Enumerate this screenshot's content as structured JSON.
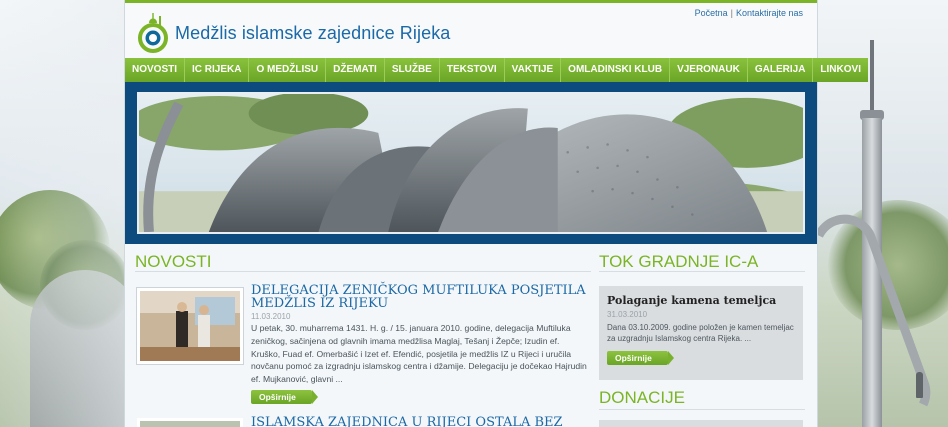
{
  "site": {
    "title": "Medžlis islamske zajednice Rijeka",
    "colors": {
      "accent_green": "#7bb426",
      "brand_blue": "#1a69a8",
      "banner_frame": "#0d4a7d"
    }
  },
  "top_links": {
    "home": "Početna",
    "separator": "|",
    "contact": "Kontaktirajte nas"
  },
  "nav": [
    "NOVOSTI",
    "IC RIJEKA",
    "O MEDŽLISU",
    "DŽEMATI",
    "SLUŽBE",
    "TEKSTOVI",
    "VAKTIJE",
    "OMLADINSKI KLUB",
    "VJERONAUK",
    "GALERIJA",
    "LINKOVI"
  ],
  "news": {
    "heading": "NOVOSTI",
    "articles": [
      {
        "title": "DELEGACIJA ZENIČKOG MUFTILUKA POSJETILA MEDŽLIS IZ RIJEKU",
        "date": "11.03.2010",
        "text": "U petak, 30. muharrema 1431. H. g. / 15. januara 2010. godine, delegacija Muftiluka zeničkog, sačinjena od glavnih imama medžlisa Maglaj, Tešanj i Žepče; Izudin ef. Kruško, Fuad ef. Omerbašić i Izet ef. Efendić, posjetila je medžlis IZ u Rijeci i uručila novčanu pomoć za izgradnju islamskog centra i džamije. Delegaciju je dočekao Hajrudin ef. Mujkanović, glavni ...",
        "more": "Opširnije"
      },
      {
        "title": "ISLAMSKA ZAJEDNICA U RIJECI OSTALA BEZ"
      }
    ]
  },
  "sidebar": {
    "heading": "TOK GRADNJE IC-A",
    "item": {
      "title": "Polaganje kamena temeljca",
      "date": "31.03.2010",
      "text": "Dana 03.10.2009. godine položen je kamen temeljac za uzgradnju Islamskog centra Rijeka. ...",
      "more": "Opširnije"
    },
    "donations_heading": "DONACIJE"
  },
  "icons": [
    "mosque-logo-icon",
    "arrow-right-icon"
  ]
}
